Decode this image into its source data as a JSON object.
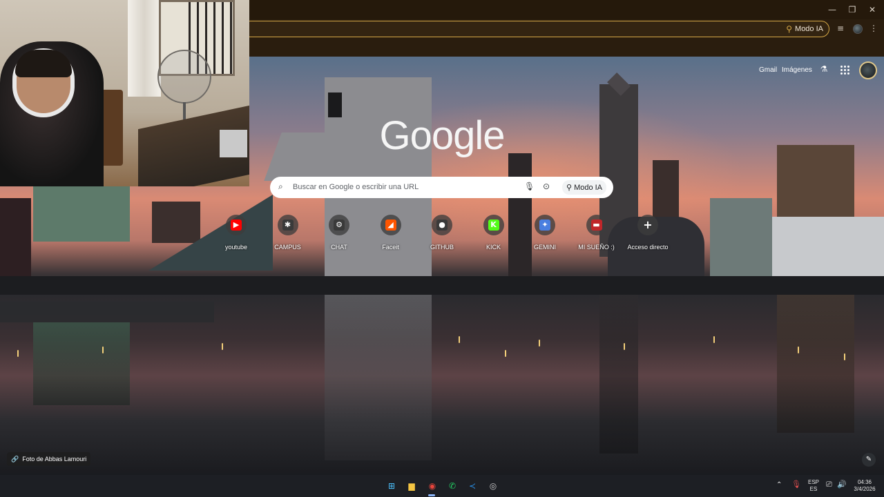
{
  "browser": {
    "omnibox_ai_label": "Modo IA",
    "window_controls": {
      "minimize": "—",
      "restore": "❐",
      "close": "✕"
    }
  },
  "ntp": {
    "logo": "Google",
    "top_links": {
      "gmail": "Gmail",
      "images": "Imágenes"
    },
    "search": {
      "placeholder": "Buscar en Google o escribir una URL",
      "ai_mode_label": "Modo IA"
    },
    "shortcuts": [
      {
        "label": "youtube",
        "icon": "youtube-icon",
        "color": "#ff0000",
        "glyph": "▶"
      },
      {
        "label": "CAMPUS",
        "icon": "campus-icon",
        "color": "#3a3a3a",
        "glyph": "✱"
      },
      {
        "label": "CHAT",
        "icon": "chatgpt-icon",
        "color": "#3a3a3a",
        "glyph": "⚙"
      },
      {
        "label": "Faceit",
        "icon": "faceit-icon",
        "color": "#ff5500",
        "glyph": "◢"
      },
      {
        "label": "GITHUB",
        "icon": "github-icon",
        "color": "#3a3a3a",
        "glyph": "●"
      },
      {
        "label": "KICK",
        "icon": "kick-icon",
        "color": "#53fc18",
        "glyph": "K"
      },
      {
        "label": "GEMINI",
        "icon": "gemini-icon",
        "color": "#4a7fe0",
        "glyph": "✦"
      },
      {
        "label": "MI SUEÑO :)",
        "icon": "dream-icon",
        "color": "#c0262a",
        "glyph": "▬"
      },
      {
        "label": "Acceso directo",
        "icon": "add-shortcut-icon",
        "color": "transparent",
        "glyph": "+"
      }
    ],
    "photo_credit": "Foto de Abbas Lamouri"
  },
  "taskbar": {
    "language": {
      "line1": "ESP",
      "line2": "ES"
    },
    "clock": {
      "time": "04:36",
      "date": "3/4/2026"
    },
    "apps": [
      {
        "name": "windows-start-icon",
        "glyph": "⊞",
        "color": "#4cc2ff"
      },
      {
        "name": "file-explorer-icon",
        "glyph": "▆",
        "color": "#f4c542"
      },
      {
        "name": "chrome-icon",
        "glyph": "◉",
        "color": "#e8453c"
      },
      {
        "name": "whatsapp-icon",
        "glyph": "✆",
        "color": "#25d366"
      },
      {
        "name": "vscode-icon",
        "glyph": "≺",
        "color": "#2a8ce0"
      },
      {
        "name": "steam-icon",
        "glyph": "◎",
        "color": "#c9c9c9"
      }
    ]
  }
}
